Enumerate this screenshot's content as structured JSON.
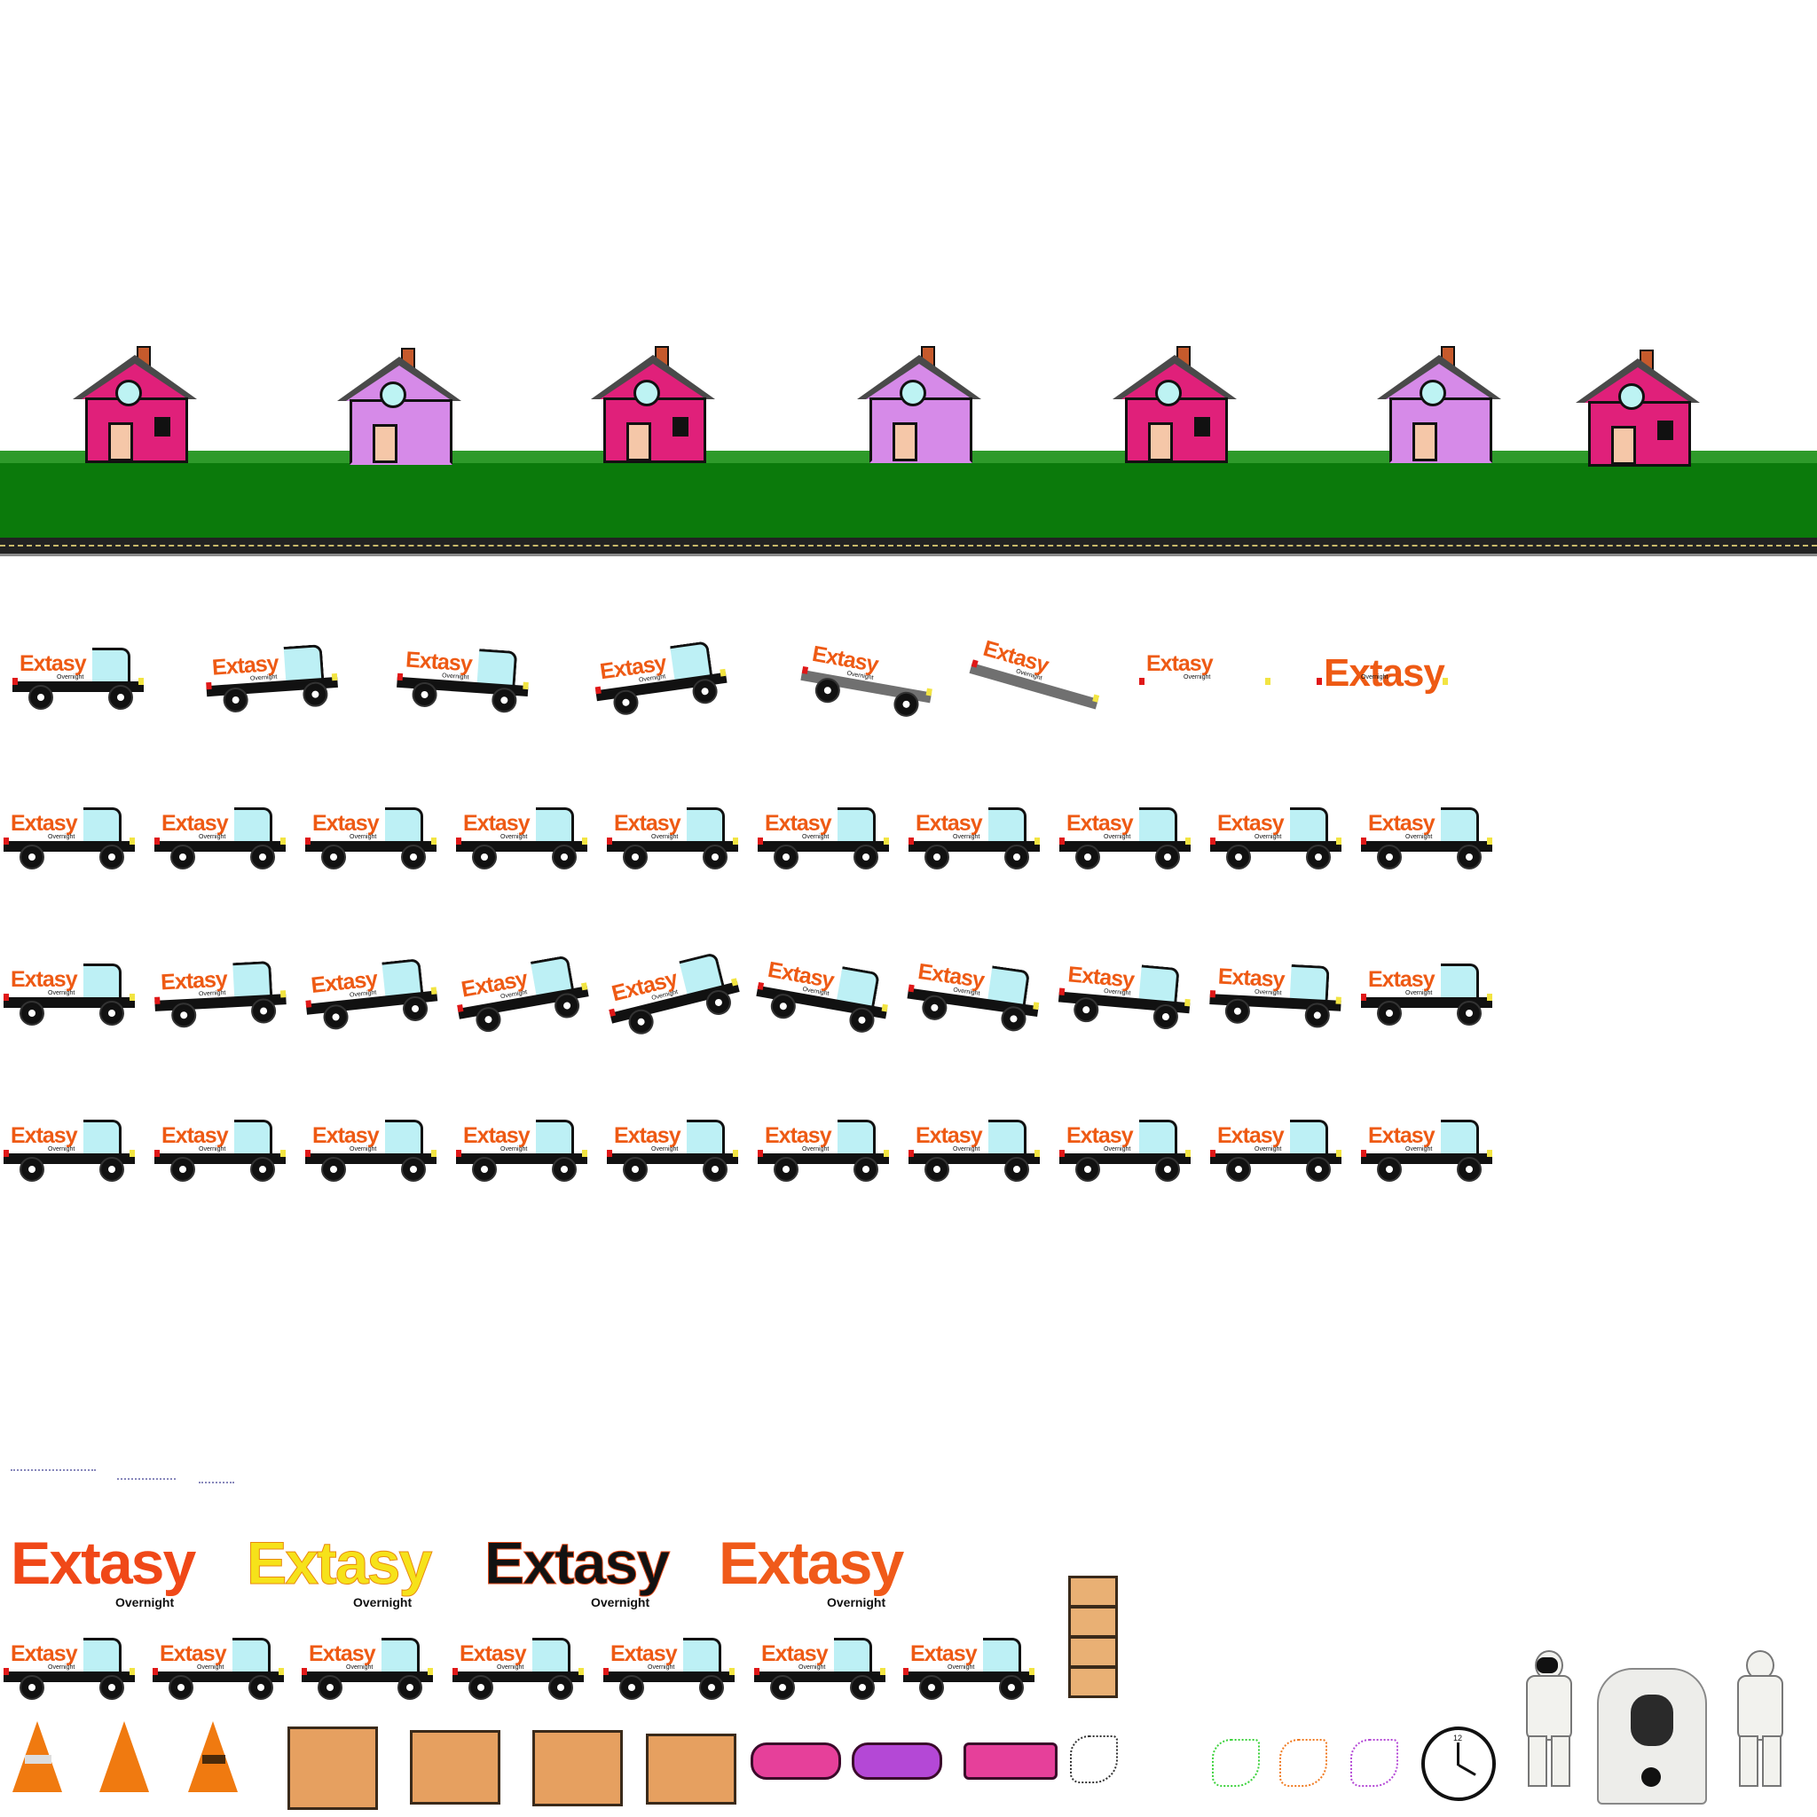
{
  "sheet": {
    "brand": "Extasy",
    "brand_sub": "Overnight"
  },
  "colors": {
    "brand_orange": "#ee5a14",
    "house_pink": "#e0207a",
    "house_violet": "#d68ae8",
    "grass": "#0b7a0b",
    "road": "#222222"
  },
  "icons": [
    "house-icon",
    "truck-icon",
    "traffic-cone-icon",
    "cardboard-box-icon",
    "bandage-icon",
    "clock-icon",
    "hazmat-suit-icon",
    "gas-mask-icon",
    "scribble-icon"
  ],
  "big_logos": [
    {
      "text": "Extasy",
      "sub": "Overnight",
      "color": "#f04818"
    },
    {
      "text": "Extasy",
      "sub": "Overnight",
      "color": "#f6e21a"
    },
    {
      "text": "Extasy",
      "sub": "Overnight",
      "color": "#121212"
    },
    {
      "text": "Extasy",
      "sub": "Overnight",
      "color": "#f05a1a"
    }
  ],
  "trucks": {
    "label": "Extasy",
    "sub": "Overnight"
  },
  "clock": {
    "number": "12"
  }
}
